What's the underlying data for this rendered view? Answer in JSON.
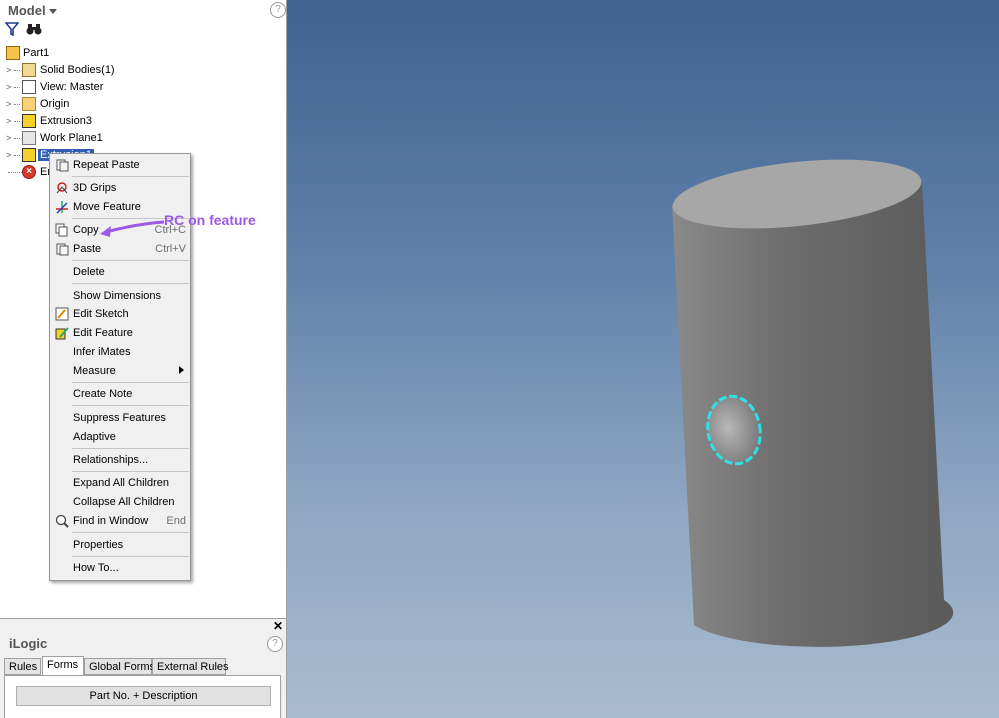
{
  "model_panel": {
    "title": "Model",
    "help": "?",
    "toolbar": {
      "filter_icon": "funnel-icon",
      "find_icon": "binoculars-icon"
    },
    "tree": [
      {
        "label": "Part1",
        "icon": "part-icon"
      },
      {
        "label": "Solid Bodies(1)",
        "icon": "solid-bodies-icon"
      },
      {
        "label": "View: Master",
        "icon": "view-icon"
      },
      {
        "label": "Origin",
        "icon": "folder-icon"
      },
      {
        "label": "Extrusion3",
        "icon": "extrusion-icon"
      },
      {
        "label": "Work Plane1",
        "icon": "work-plane-icon"
      },
      {
        "label": "Extrusion1",
        "icon": "extrusion-icon"
      },
      {
        "label": "En",
        "icon": "end-of-part-icon"
      }
    ]
  },
  "context_menu": {
    "items": [
      {
        "label": "Repeat Paste",
        "shortcut": ""
      },
      {
        "label": "3D Grips",
        "shortcut": ""
      },
      {
        "label": "Move Feature",
        "shortcut": ""
      },
      {
        "label": "Copy",
        "shortcut": "Ctrl+C"
      },
      {
        "label": "Paste",
        "shortcut": "Ctrl+V"
      },
      {
        "label": "Delete",
        "shortcut": ""
      },
      {
        "label": "Show Dimensions",
        "shortcut": ""
      },
      {
        "label": "Edit Sketch",
        "shortcut": ""
      },
      {
        "label": "Edit Feature",
        "shortcut": ""
      },
      {
        "label": "Infer iMates",
        "shortcut": ""
      },
      {
        "label": "Measure",
        "shortcut": ""
      },
      {
        "label": "Create Note",
        "shortcut": ""
      },
      {
        "label": "Suppress Features",
        "shortcut": ""
      },
      {
        "label": "Adaptive",
        "shortcut": ""
      },
      {
        "label": "Relationships...",
        "shortcut": ""
      },
      {
        "label": "Expand All Children",
        "shortcut": ""
      },
      {
        "label": "Collapse All Children",
        "shortcut": ""
      },
      {
        "label": "Find in Window",
        "shortcut": "End"
      },
      {
        "label": "Properties",
        "shortcut": ""
      },
      {
        "label": "How To...",
        "shortcut": ""
      }
    ]
  },
  "annotation": {
    "text": "RC on feature",
    "color": "#9b59e6"
  },
  "ilogic": {
    "close": "✕",
    "title": "iLogic",
    "help": "?",
    "tabs": [
      "Rules",
      "Forms",
      "Global Forms",
      "External Rules"
    ],
    "active_tab": "Forms",
    "button_label": "Part No. + Description"
  },
  "viewport": {
    "model": "cylinder-with-hole",
    "highlight_color": "#2fe0e8"
  }
}
